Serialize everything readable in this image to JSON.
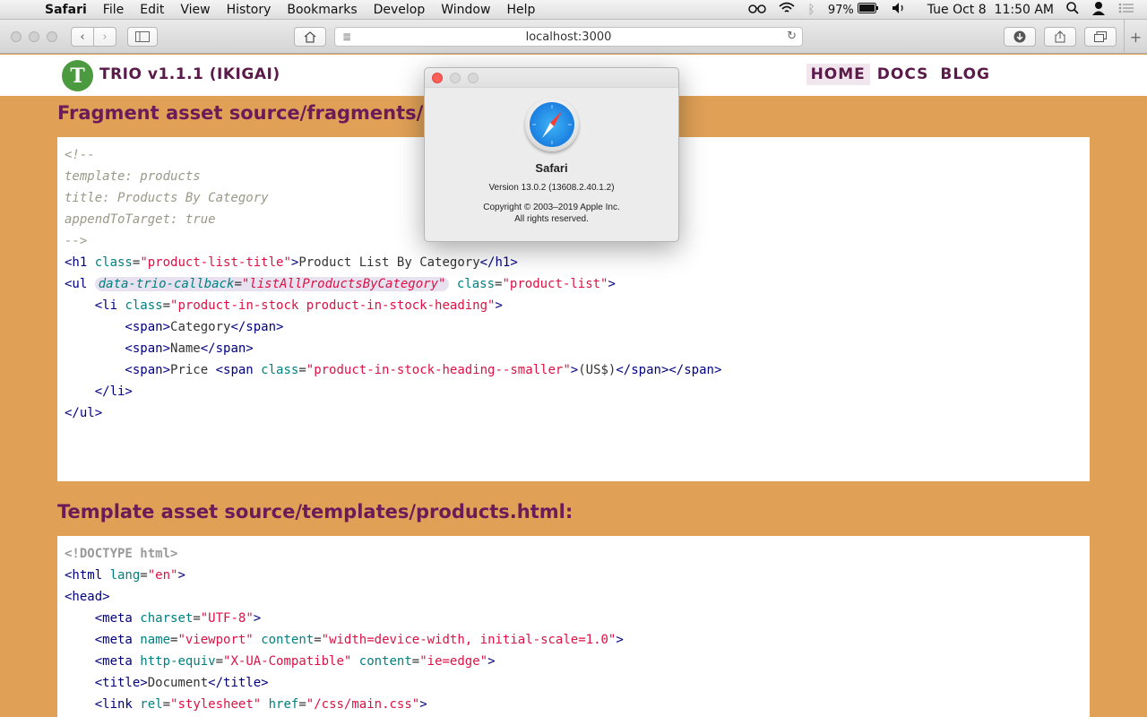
{
  "menubar": {
    "app": "Safari",
    "menus": [
      "File",
      "Edit",
      "View",
      "History",
      "Bookmarks",
      "Develop",
      "Window",
      "Help"
    ],
    "battery": "97%",
    "datetime": "Tue Oct 8  11:50 AM"
  },
  "toolbar": {
    "address": "localhost:3000"
  },
  "site": {
    "logo_letter": "T",
    "brand": "TRIO v1.1.1 (IKIGAI)",
    "nav": [
      "HOME",
      "DOCS",
      "BLOG"
    ],
    "active_nav": "HOME"
  },
  "fragment": {
    "heading": "Fragment asset source/fragments/p",
    "lines": {
      "l1": "<!--",
      "l2": "template: products",
      "l3": "title: Products By Category",
      "l4": "appendToTarget: true",
      "l5": "-->",
      "l6_open": "<h1 ",
      "l6_attr": "class",
      "l6_eq": "=",
      "l6_val": "\"product-list-title\"",
      "l6_gt": ">",
      "l6_text": "Product List By Category",
      "l6_close": "</h1>",
      "l7_open": "<ul ",
      "l7_attr1": "data-trio-callback",
      "l7_eq1": "=",
      "l7_val1": "\"listAllProductsByCategory\"",
      "l7_attr2": "class",
      "l7_eq2": "=",
      "l7_val2": "\"product-list\"",
      "l7_gt": ">",
      "l8_open": "    <li ",
      "l8_attr": "class",
      "l8_eq": "=",
      "l8_val": "\"product-in-stock product-in-stock-heading\"",
      "l8_gt": ">",
      "l9_open": "        <span>",
      "l9_text": "Category",
      "l9_close": "</span>",
      "l10_open": "        <span>",
      "l10_text": "Name",
      "l10_close": "</span>",
      "l11_open": "        <span>",
      "l11_text": "Price ",
      "l11_open2": "<span ",
      "l11_attr": "class",
      "l11_eq": "=",
      "l11_val": "\"product-in-stock-heading--smaller\"",
      "l11_gt": ">",
      "l11_text2": "(US$)",
      "l11_close": "</span></span>",
      "l12": "    </li>",
      "l13": "</ul>"
    }
  },
  "template": {
    "heading": "Template asset source/templates/products.html:",
    "lines": {
      "l1": "<!DOCTYPE html>",
      "l2_open": "<html ",
      "l2_attr": "lang",
      "l2_eq": "=",
      "l2_val": "\"en\"",
      "l2_gt": ">",
      "l3": "<head>",
      "l4_open": "    <meta ",
      "l4_attr": "charset",
      "l4_eq": "=",
      "l4_val": "\"UTF-8\"",
      "l4_gt": ">",
      "l5_open": "    <meta ",
      "l5_attr1": "name",
      "l5_eq1": "=",
      "l5_val1": "\"viewport\"",
      "l5_attr2": "content",
      "l5_eq2": "=",
      "l5_val2": "\"width=device-width, initial-scale=1.0\"",
      "l5_gt": ">",
      "l6_open": "    <meta ",
      "l6_attr1": "http-equiv",
      "l6_eq1": "=",
      "l6_val1": "\"X-UA-Compatible\"",
      "l6_attr2": "content",
      "l6_eq2": "=",
      "l6_val2": "\"ie=edge\"",
      "l6_gt": ">",
      "l7_open": "    <title>",
      "l7_text": "Document",
      "l7_close": "</title>",
      "l8_open": "    <link ",
      "l8_attr1": "rel",
      "l8_eq1": "=",
      "l8_val1": "\"stylesheet\"",
      "l8_attr2": "href",
      "l8_eq2": "=",
      "l8_val2": "\"/css/main.css\"",
      "l8_gt": ">"
    }
  },
  "about": {
    "name": "Safari",
    "version": "Version 13.0.2 (13608.2.40.1.2)",
    "copyright": "Copyright © 2003–2019 Apple Inc.",
    "rights": "All rights reserved."
  }
}
